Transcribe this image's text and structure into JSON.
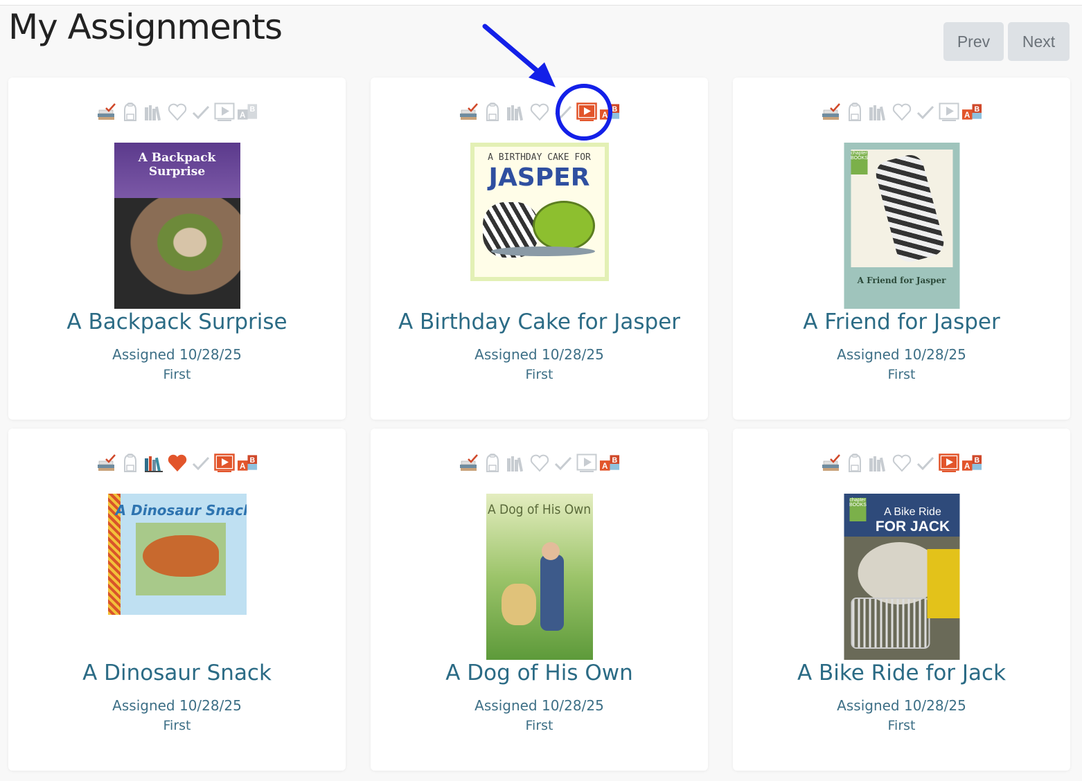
{
  "page": {
    "title": "My Assignments",
    "prev_label": "Prev",
    "next_label": "Next"
  },
  "colors": {
    "accent_text": "#2b6b85",
    "active_icon": "#e2552b",
    "inactive_icon": "#c7ccd1",
    "annotation": "#1320e8"
  },
  "toolbar_icons": [
    "books-check-icon",
    "backpack-icon",
    "library-icon",
    "heart-icon",
    "checkmark-icon",
    "video-play-icon",
    "ab-letters-icon"
  ],
  "assignments": [
    {
      "title": "A Backpack Surprise",
      "assigned": "Assigned 10/28/25",
      "level": "First",
      "cover_title": "A Backpack Surprise",
      "heart_active": false,
      "library_active": false,
      "video_active": false,
      "ab_active": false
    },
    {
      "title": "A Birthday Cake for Jasper",
      "assigned": "Assigned 10/28/25",
      "level": "First",
      "cover_line1": "A BIRTHDAY CAKE FOR",
      "cover_line2": "JASPER",
      "heart_active": false,
      "library_active": false,
      "video_active": true,
      "ab_active": true
    },
    {
      "title": "A Friend for Jasper",
      "assigned": "Assigned 10/28/25",
      "level": "First",
      "cover_title": "A Friend for Jasper",
      "cover_badge": "chapter BOOKS",
      "heart_active": false,
      "library_active": false,
      "video_active": false,
      "ab_active": true
    },
    {
      "title": "A Dinosaur Snack",
      "assigned": "Assigned 10/28/25",
      "level": "First",
      "cover_title": "A Dinosaur Snack",
      "heart_active": true,
      "library_active": true,
      "video_active": true,
      "ab_active": true
    },
    {
      "title": "A Dog of His Own",
      "assigned": "Assigned 10/28/25",
      "level": "First",
      "cover_title": "A Dog of His Own",
      "heart_active": false,
      "library_active": false,
      "video_active": false,
      "ab_active": true
    },
    {
      "title": "A Bike Ride for Jack",
      "assigned": "Assigned 10/28/25",
      "level": "First",
      "cover_line1": "A Bike Ride",
      "cover_line2": "FOR JACK",
      "cover_badge": "chapter BOOKS",
      "heart_active": false,
      "library_active": false,
      "video_active": true,
      "ab_active": true
    }
  ]
}
